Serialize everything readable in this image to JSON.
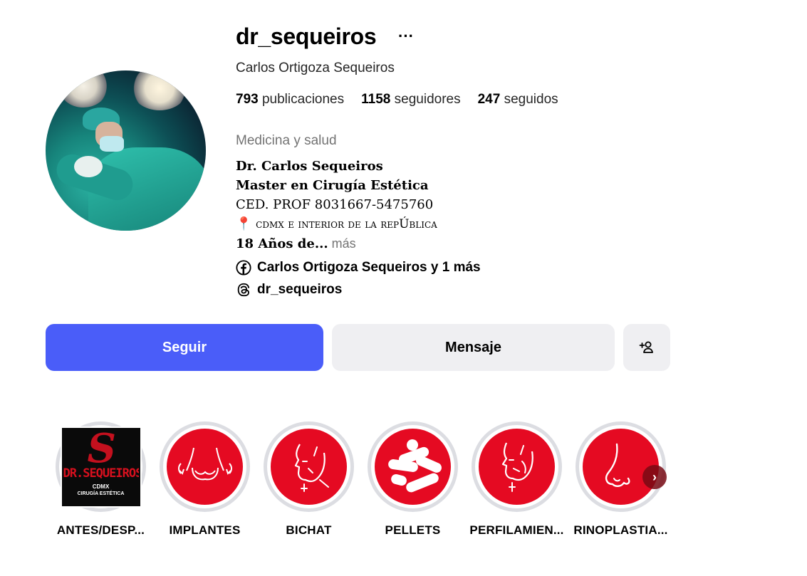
{
  "profile": {
    "username": "dr_sequeiros",
    "more_glyph": "···",
    "full_name": "Carlos Ortigoza Sequeiros",
    "avatar_icon": "profile-photo-surgeon",
    "stats": {
      "posts_count": "793",
      "posts_label": "publicaciones",
      "followers_count": "1158",
      "followers_label": "seguidores",
      "following_count": "247",
      "following_label": "seguidos"
    },
    "category": "Medicina y salud",
    "bio": {
      "line1": "Dr. Carlos Sequeiros",
      "line2": "Master en Cirugía Estética",
      "line3": "CED. PROF 8031667-5475760",
      "pin_glyph": "📍",
      "line4": "cdmx e interior de la repÚblica",
      "line5": "18 Años de...",
      "more_label": " más"
    },
    "links": {
      "facebook": "Carlos Ortigoza Sequeiros y 1 más",
      "threads": "dr_sequeiros"
    }
  },
  "actions": {
    "follow_label": "Seguir",
    "message_label": "Mensaje",
    "add_icon": "add-person-icon"
  },
  "colors": {
    "follow_bg": "#4a5df9",
    "secondary_bg": "#efeff2",
    "highlight_red": "#e50a22"
  },
  "highlights": [
    {
      "label": "ANTES/DESP...",
      "icon": "dr-sequeiros-logo",
      "logo_name": "DR.SEQUEIROS",
      "logo_sub1": "CDMX",
      "logo_sub2": "CIRUGÍA ESTÉTICA"
    },
    {
      "label": "IMPLANTES",
      "icon": "breast-implant-icon"
    },
    {
      "label": "BICHAT",
      "icon": "face-profile-icon"
    },
    {
      "label": "PELLETS",
      "icon": "pellets-icon"
    },
    {
      "label": "PERFILAMIEN...",
      "icon": "face-contour-icon"
    },
    {
      "label": "RINOPLASTIA...",
      "icon": "nose-icon"
    }
  ]
}
